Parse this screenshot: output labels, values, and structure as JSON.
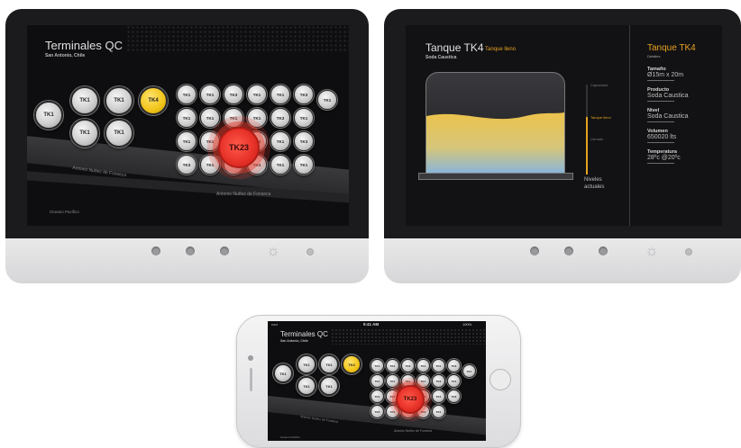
{
  "map_screen": {
    "title": "Terminales QC",
    "subtitle": "San Antonio, Chile",
    "large_tanks": [
      "TK1",
      "TK1",
      "TK1",
      "TK1",
      "TK1"
    ],
    "selected_tank": "TK4",
    "alert_tank": "TK23",
    "small_tanks": [
      "TK1",
      "TK1",
      "TK3",
      "TK1",
      "TK1",
      "TK3",
      "TK1",
      "TK1",
      "TK1",
      "TK1",
      "TK1",
      "TK3",
      "TK1",
      "TK1",
      "TK1",
      "TK1",
      "TK3",
      "TK1",
      "TK3",
      "TK3",
      "TK1",
      "TK1",
      "TK3",
      "TK1",
      "TK1"
    ],
    "road_label": "Antonio Nuñez de Fonseca",
    "ocean_label": "Oceano Pacifico"
  },
  "detail_screen": {
    "title": "Tanque TK4",
    "status": "Tanque lleno",
    "subtitle": "Soda Caustica",
    "gauge_top": "Capacidad",
    "gauge_fill_label": "Tanque lleno",
    "gauge_low": "Llenado",
    "levels_label": "Niveles actuales",
    "panel": {
      "title": "Tanque TK4",
      "subtitle": "Detalles",
      "fields": [
        {
          "label": "Tamaño",
          "value": "Ø15m x 20m"
        },
        {
          "label": "Producto",
          "value": "Soda Caustica"
        },
        {
          "label": "Nivel",
          "value": "Soda Caustica"
        },
        {
          "label": "Volumen",
          "value": "650020 lts"
        },
        {
          "label": "Temperatura",
          "value": "28ºc @20ºc"
        }
      ]
    }
  },
  "phone": {
    "time": "9:41 AM",
    "carrier": "•••••",
    "battery": "100%",
    "title": "Terminales QC",
    "subtitle": "San Antonio, Chile",
    "alert_tank": "TK23",
    "selected_tank": "TK4",
    "large_tanks": [
      "TK1",
      "TK1",
      "TK1",
      "TK1",
      "TK1"
    ],
    "road_label": "Antonio Nuñez de Fonseca",
    "road_label_2": "Antonio Nuñez de Fonseca",
    "ocean_label": "Oceano Pacifico"
  },
  "colors": {
    "accent": "#e6a21f",
    "alert": "#e8332a",
    "selected": "#f0c419",
    "liquid_top": "#e8c04a",
    "liquid_bottom": "#7fb3e6"
  }
}
